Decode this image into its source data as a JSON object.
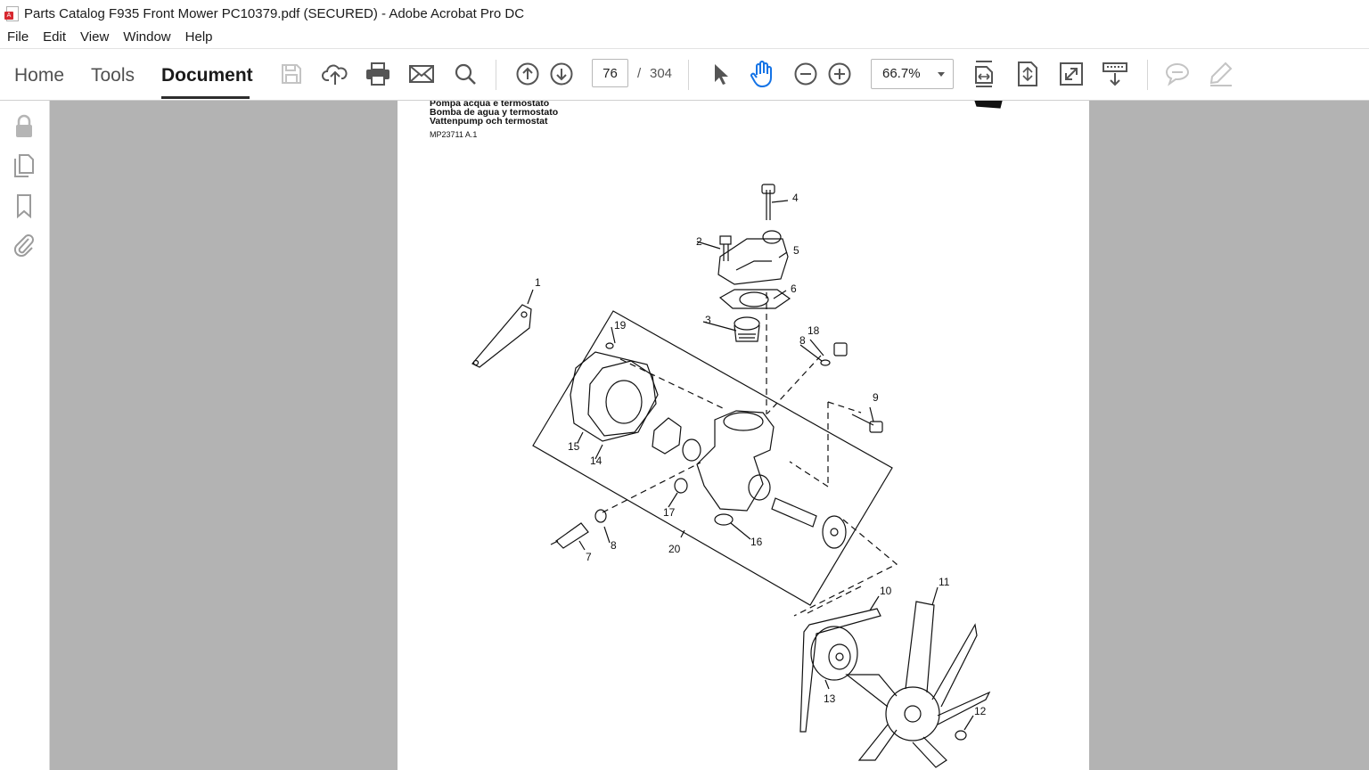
{
  "window": {
    "title": "Parts Catalog F935 Front Mower PC10379.pdf (SECURED) - Adobe Acrobat Pro DC"
  },
  "menu": [
    "File",
    "Edit",
    "View",
    "Window",
    "Help"
  ],
  "tabs": {
    "home": "Home",
    "tools": "Tools",
    "document": "Document",
    "active": "Document"
  },
  "toolbar": {
    "icons": [
      "save-icon",
      "upload-cloud-icon",
      "print-icon",
      "email-icon",
      "search-icon",
      "previous-page-icon",
      "next-page-icon",
      "select-arrow-icon",
      "hand-icon",
      "zoom-out-icon",
      "zoom-in-icon",
      "fit-width-icon",
      "fit-page-icon",
      "full-screen-icon",
      "scrolling-mode-icon",
      "comment-icon",
      "highlight-pen-icon"
    ],
    "page_current": "76",
    "page_separator": "/",
    "page_total": "304",
    "zoom": "66.7%"
  },
  "left_panel": {
    "icons": [
      "lock-icon",
      "pages-icon",
      "bookmark-icon",
      "attachment-icon"
    ]
  },
  "document": {
    "header_lines": [
      "Pompa acqua e termostato",
      "Bomba de agua y termostato",
      "Vattenpump och termostat"
    ],
    "figure_code": "MP23711 A.1",
    "callouts": [
      "1",
      "2",
      "3",
      "4",
      "5",
      "6",
      "7",
      "8",
      "8",
      "9",
      "10",
      "11",
      "12",
      "13",
      "14",
      "15",
      "16",
      "17",
      "18",
      "19",
      "20"
    ]
  },
  "colors": {
    "canvas_bg": "#b3b3b3",
    "page_bg": "#ffffff",
    "accent_hand": "#1473e6"
  }
}
